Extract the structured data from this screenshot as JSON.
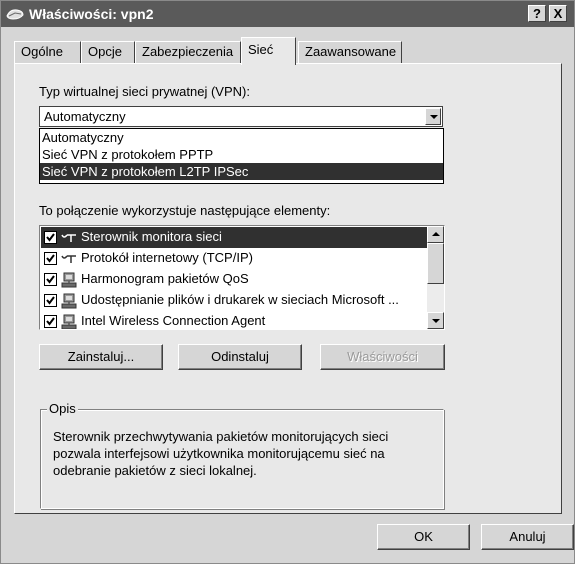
{
  "window": {
    "title": "Właściwości: vpn2",
    "help_label": "?",
    "close_label": "X"
  },
  "tabs": [
    {
      "label": "Ogólne"
    },
    {
      "label": "Opcje"
    },
    {
      "label": "Zabezpieczenia"
    },
    {
      "label": "Sieć"
    },
    {
      "label": "Zaawansowane"
    }
  ],
  "vpn_type": {
    "label": "Typ wirtualnej sieci prywatnej (VPN):",
    "selected": "Automatyczny",
    "options": [
      "Automatyczny",
      "Sieć VPN z protokołem PPTP",
      "Sieć VPN z protokołem L2TP IPSec"
    ]
  },
  "components": {
    "label": "To połączenie wykorzystuje następujące elementy:",
    "items": [
      {
        "label": "Sterownik monitora sieci",
        "checked": true,
        "icon": "network-protocol-icon"
      },
      {
        "label": "Protokół internetowy (TCP/IP)",
        "checked": true,
        "icon": "network-protocol-icon"
      },
      {
        "label": "Harmonogram pakietów QoS",
        "checked": true,
        "icon": "network-service-icon"
      },
      {
        "label": "Udostępnianie plików i drukarek w sieciach Microsoft ...",
        "checked": true,
        "icon": "network-service-icon"
      },
      {
        "label": "Intel Wireless Connection Agent",
        "checked": true,
        "icon": "network-service-icon"
      }
    ]
  },
  "buttons": {
    "install": "Zainstaluj...",
    "uninstall": "Odinstaluj",
    "properties": "Właściwości",
    "ok": "OK",
    "cancel": "Anuluj"
  },
  "description": {
    "title": "Opis",
    "text": "Sterownik przechwytywania pakietów monitorujących sieci pozwala interfejsowi użytkownika monitorującemu sieć na odebranie pakietów z sieci lokalnej."
  },
  "colors": {
    "title_bar": "#5a5a5a",
    "selection": "#303030",
    "dialog": "#d6d6d6",
    "panel": "#e8e8e8"
  }
}
